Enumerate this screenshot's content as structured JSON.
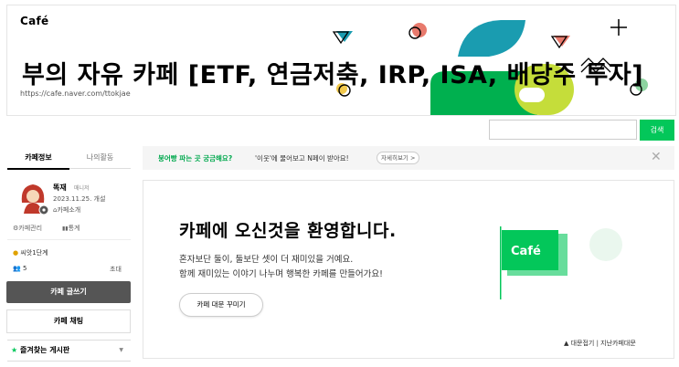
{
  "header": {
    "logo": "Café",
    "title": "부의 자유 카페 [ETF, 연금저축, IRP, ISA, 배당주 투자]",
    "url": "https://cafe.naver.com/ttokjae"
  },
  "search": {
    "placeholder": "",
    "button_label": "검색"
  },
  "sidebar": {
    "tabs": [
      {
        "label": "카페정보"
      },
      {
        "label": "나의활동"
      }
    ],
    "manager": {
      "name": "똑재",
      "badge": "매니저",
      "created": "2023.11.25. 개설",
      "intro_link": "카페소개"
    },
    "manage_link": "카페관리",
    "stats_link": "통계",
    "level": "씨앗1단계",
    "member_count": "5",
    "invite_link": "초대",
    "write_button": "카페 글쓰기",
    "chat_button": "카페 채팅",
    "favorite_board": "즐겨찾는 게시판"
  },
  "notice": {
    "highlight": "붕어빵 파는 곳 궁금해요?",
    "text": "'이웃'에 물어보고 N페이 받아요!",
    "more_button": "자세히보기 >"
  },
  "welcome": {
    "title": "카페에 오신것을 환영합니다.",
    "line1": "혼자보단 둘이, 둘보단 셋이 더 재미있을 거예요.",
    "line2": "함께 재미있는 이야기 나누며 행복한 카페를 만들어가요!",
    "decorate_button": "카페 대문 꾸미기",
    "fold_link": "▲ 대문접기 | 지난카페대문",
    "flag_text": "Café"
  },
  "colors": {
    "accent": "#03c75a",
    "green_dark": "#00b04f",
    "teal": "#1a9cb0"
  }
}
